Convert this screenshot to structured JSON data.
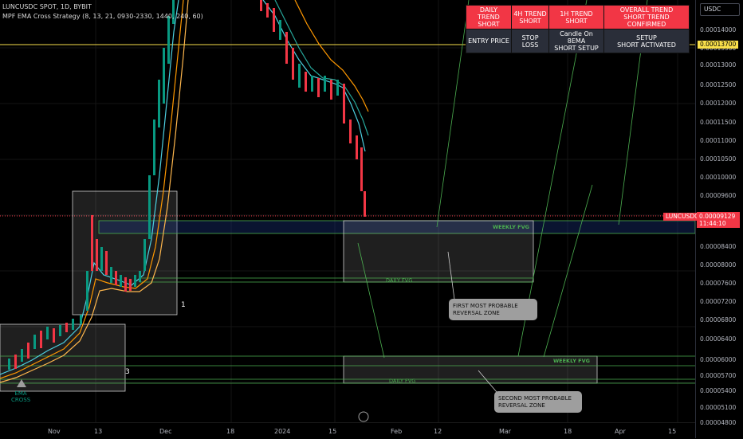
{
  "legend": {
    "symbol_line": "LUNCUSDC SPOT, 1D, BYBIT",
    "strategy_line": "MPF EMA Cross Strategy (8, 13, 21, 0930-2330, 1440, 240, 60)"
  },
  "trend_table": {
    "header": [
      "DAILY TREND\nSHORT",
      "4H TREND\nSHORT",
      "1H TREND\nSHORT",
      "OVERALL TREND\nSHORT TREND CONFIRMED"
    ],
    "row": [
      "ENTRY PRICE",
      "STOP LOSS",
      "Candle On 8EMA\nSHORT SETUP",
      "SETUP\nSHORT ACTIVATED"
    ]
  },
  "currency_button": "USDC",
  "price_axis": [
    "0.00014000",
    "0.00013500",
    "0.00013000",
    "0.00012500",
    "0.00012000",
    "0.00011500",
    "0.00011000",
    "0.00010500",
    "0.00010000",
    "0.00009600",
    "0.00008800",
    "0.00008400",
    "0.00008000",
    "0.00007600",
    "0.00007200",
    "0.00006800",
    "0.00006400",
    "0.00006000",
    "0.00005700",
    "0.00005400",
    "0.00005100",
    "0.00004800"
  ],
  "price_tags": {
    "level_price": "0.00013700",
    "symbol": "LUNCUSDC",
    "last_price": "0.00009129",
    "countdown": "11:44:10"
  },
  "time_axis": [
    "Nov",
    "13",
    "Dec",
    "18",
    "2024",
    "15",
    "Feb",
    "12",
    "Mar",
    "18",
    "Apr",
    "15"
  ],
  "annotations": {
    "box1_label": "1",
    "box3_label": "3",
    "weekly_fvg_1": "WEEKLY FVG",
    "daily_fvg_1": "DAILY FVG",
    "weekly_fvg_2": "WEEKLY FVG",
    "daily_fvg_2": "DAILY FVG",
    "ema_cross": "EMA\nCROSS",
    "note1": "FIRST MOST PROBABLE\nREVERSAL ZONE",
    "note2": "SECOND MOST PROBABLE\nREVERSAL ZONE"
  },
  "colors": {
    "background": "#000000",
    "bull": "#089981",
    "bear": "#f23645",
    "ema8": "#4dd0e1",
    "ema13": "#ff9800",
    "ema21": "#ffb74d",
    "fvg_line": "#4caf50",
    "level_line": "#f9e04b",
    "price_tag": "#f23645"
  }
}
